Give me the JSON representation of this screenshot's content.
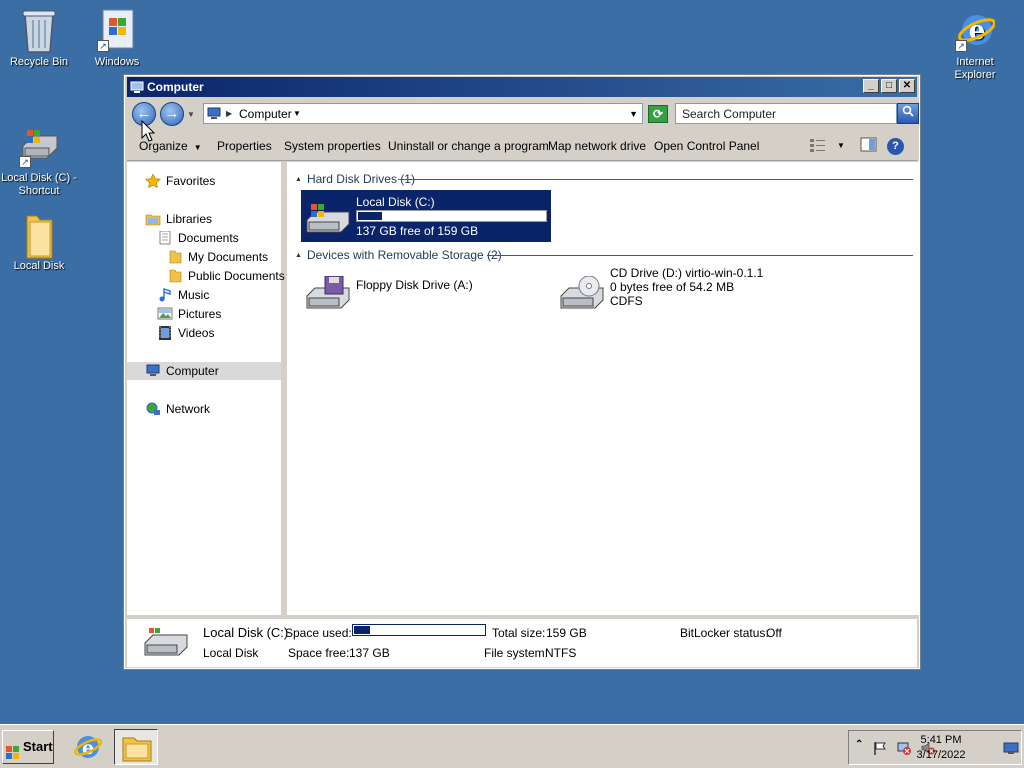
{
  "desktop": {
    "icons": [
      {
        "label": "Recycle Bin",
        "icon": "recycle-bin-icon"
      },
      {
        "label": "Windows Upda...",
        "icon": "windows-update-icon"
      },
      {
        "label": "Internet Explorer",
        "icon": "internet-explorer-icon"
      },
      {
        "label": "Local Disk (C) - Shortcut",
        "icon": "hard-disk-icon"
      },
      {
        "label": "Local Disk",
        "icon": "folder-icon"
      }
    ]
  },
  "window": {
    "title": "Computer",
    "controls": {
      "minimize": "_",
      "maximize": "□",
      "close": "✕"
    },
    "address": {
      "crumb": "Computer"
    },
    "search": {
      "placeholder": "Search Computer"
    },
    "commands": [
      "Organize",
      "Properties",
      "System properties",
      "Uninstall or change a program",
      "Map network drive",
      "Open Control Panel"
    ],
    "help_glyph": "?",
    "nav": {
      "favorites": "Favorites",
      "libraries": "Libraries",
      "documents": "Documents",
      "my_documents": "My Documents",
      "public_documents": "Public Documents",
      "music": "Music",
      "pictures": "Pictures",
      "videos": "Videos",
      "computer": "Computer",
      "network": "Network"
    },
    "groups": {
      "hdd": "Hard Disk Drives (1)",
      "removable": "Devices with Removable Storage (2)"
    },
    "drives": {
      "c": {
        "name": "Local Disk (C:)",
        "free": "137 GB free of 159 GB",
        "used_fraction": 0.14
      },
      "a": {
        "name": "Floppy Disk Drive (A:)"
      },
      "d": {
        "name": "CD Drive (D:) virtio-win-0.1.1",
        "free": "0 bytes free of 54.2 MB",
        "fs": "CDFS"
      }
    },
    "details": {
      "name": "Local Disk (C:)",
      "type": "Local Disk",
      "space_used_label": "Space used:",
      "space_free_label": "Space free:",
      "space_free": "137 GB",
      "total_size_label": "Total size:",
      "total_size": "159 GB",
      "filesystem_label": "File system:",
      "filesystem": "NTFS",
      "bitlocker_label": "BitLocker status:",
      "bitlocker": "Off",
      "used_fraction": 0.14
    }
  },
  "taskbar": {
    "start_label": "Start",
    "clock_time": "5:41 PM",
    "clock_date": "3/17/2022"
  },
  "colors": {
    "desktop": "#3a6ea5",
    "selection": "#0a246a",
    "chrome": "#d4d0c8"
  }
}
